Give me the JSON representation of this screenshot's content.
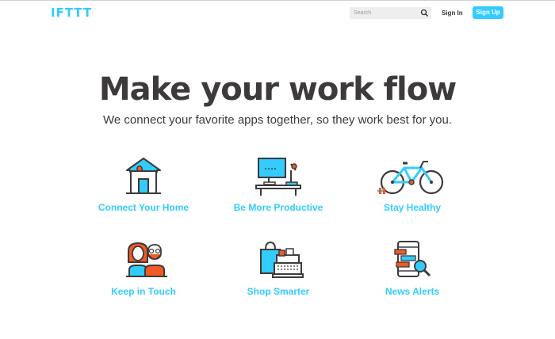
{
  "header": {
    "logo": "IFTTT",
    "search_placeholder": "Search",
    "sign_in": "Sign In",
    "sign_up": "Sign Up"
  },
  "hero": {
    "title": "Make your work flow",
    "subtitle": "We connect your favorite apps together, so they work best for you."
  },
  "categories": [
    {
      "label": "Connect Your Home",
      "icon": "house-icon"
    },
    {
      "label": "Be More Productive",
      "icon": "desk-computer-icon"
    },
    {
      "label": "Stay Healthy",
      "icon": "bicycle-icon"
    },
    {
      "label": "Keep in Touch",
      "icon": "people-icon"
    },
    {
      "label": "Shop Smarter",
      "icon": "shopping-register-icon"
    },
    {
      "label": "News Alerts",
      "icon": "phone-news-icon"
    }
  ],
  "colors": {
    "accent": "#33ccff",
    "orange": "#f15a24",
    "dark": "#3e3a3b"
  }
}
